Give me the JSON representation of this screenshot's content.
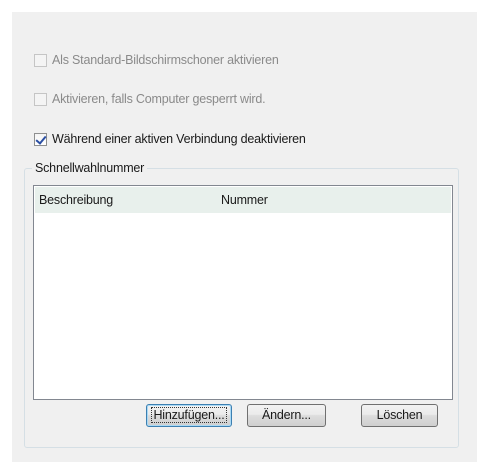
{
  "options": {
    "screensaver_default": {
      "label": "Als Standard-Bildschirmschoner aktivieren",
      "checked": false,
      "enabled": false
    },
    "activate_when_locked": {
      "label": "Aktivieren, falls Computer gesperrt wird.",
      "checked": false,
      "enabled": false
    },
    "deactivate_during_connection": {
      "label": "Während einer aktiven Verbindung deaktivieren",
      "checked": true,
      "enabled": true
    }
  },
  "speed_dial": {
    "group_title": "Schnellwahlnummer",
    "columns": [
      "Beschreibung",
      "Nummer"
    ],
    "rows": []
  },
  "buttons": {
    "add": "Hinzufügen...",
    "edit": "Ändern...",
    "delete": "Löschen"
  }
}
